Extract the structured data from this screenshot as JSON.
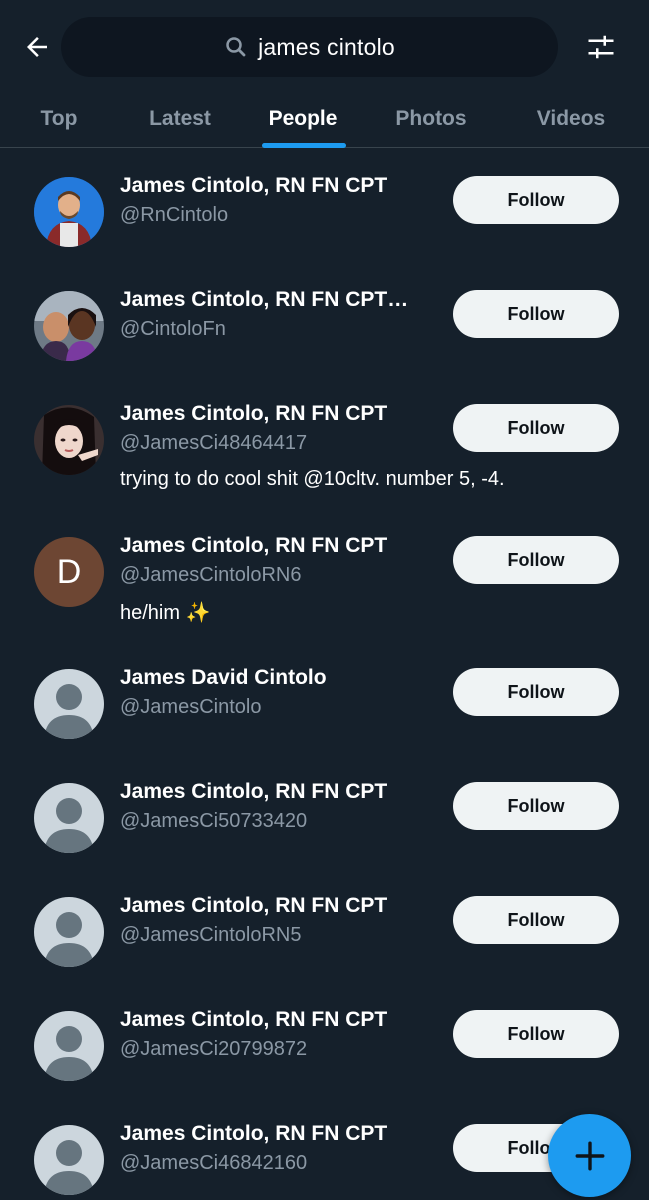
{
  "search": {
    "query": "james cintolo"
  },
  "icons": {
    "back": "arrow-left-icon",
    "search": "search-icon",
    "filter": "sliders-icon",
    "compose": "plus-icon"
  },
  "colors": {
    "background": "#15202b",
    "accent": "#1d9bf0",
    "button": "#eff3f4",
    "secondary_text": "#8b98a5"
  },
  "tabs": [
    {
      "label": "Top",
      "active": false
    },
    {
      "label": "Latest",
      "active": false
    },
    {
      "label": "People",
      "active": true
    },
    {
      "label": "Photos",
      "active": false
    },
    {
      "label": "Videos",
      "active": false
    }
  ],
  "people": [
    {
      "name": "James Cintolo, RN FN CPT",
      "handle": "@RnCintolo",
      "bio": "",
      "avatar": "photo",
      "follow_label": "Follow"
    },
    {
      "name": "James Cintolo, RN FN CPT…",
      "handle": "@CintoloFn",
      "bio": "",
      "avatar": "photo",
      "follow_label": "Follow"
    },
    {
      "name": "James Cintolo, RN FN CPT",
      "handle": "@JamesCi48464417",
      "bio": "trying to do cool shit @10cltv. number 5, -4.",
      "avatar": "photo",
      "follow_label": "Follow"
    },
    {
      "name": "James Cintolo, RN FN CPT",
      "handle": "@JamesCintoloRN6",
      "bio": "he/him ✨",
      "avatar": "letter",
      "avatar_letter": "D",
      "follow_label": "Follow"
    },
    {
      "name": "James David Cintolo",
      "handle": "@JamesCintolo",
      "bio": "",
      "avatar": "default",
      "follow_label": "Follow"
    },
    {
      "name": "James Cintolo, RN FN CPT",
      "handle": "@JamesCi50733420",
      "bio": "",
      "avatar": "default",
      "follow_label": "Follow"
    },
    {
      "name": "James Cintolo, RN FN CPT",
      "handle": "@JamesCintoloRN5",
      "bio": "",
      "avatar": "default",
      "follow_label": "Follow"
    },
    {
      "name": "James Cintolo, RN FN CPT",
      "handle": "@JamesCi20799872",
      "bio": "",
      "avatar": "default",
      "follow_label": "Follow"
    },
    {
      "name": "James Cintolo, RN FN CPT",
      "handle": "@JamesCi46842160",
      "bio": "",
      "avatar": "default",
      "follow_label": "Follow"
    }
  ]
}
